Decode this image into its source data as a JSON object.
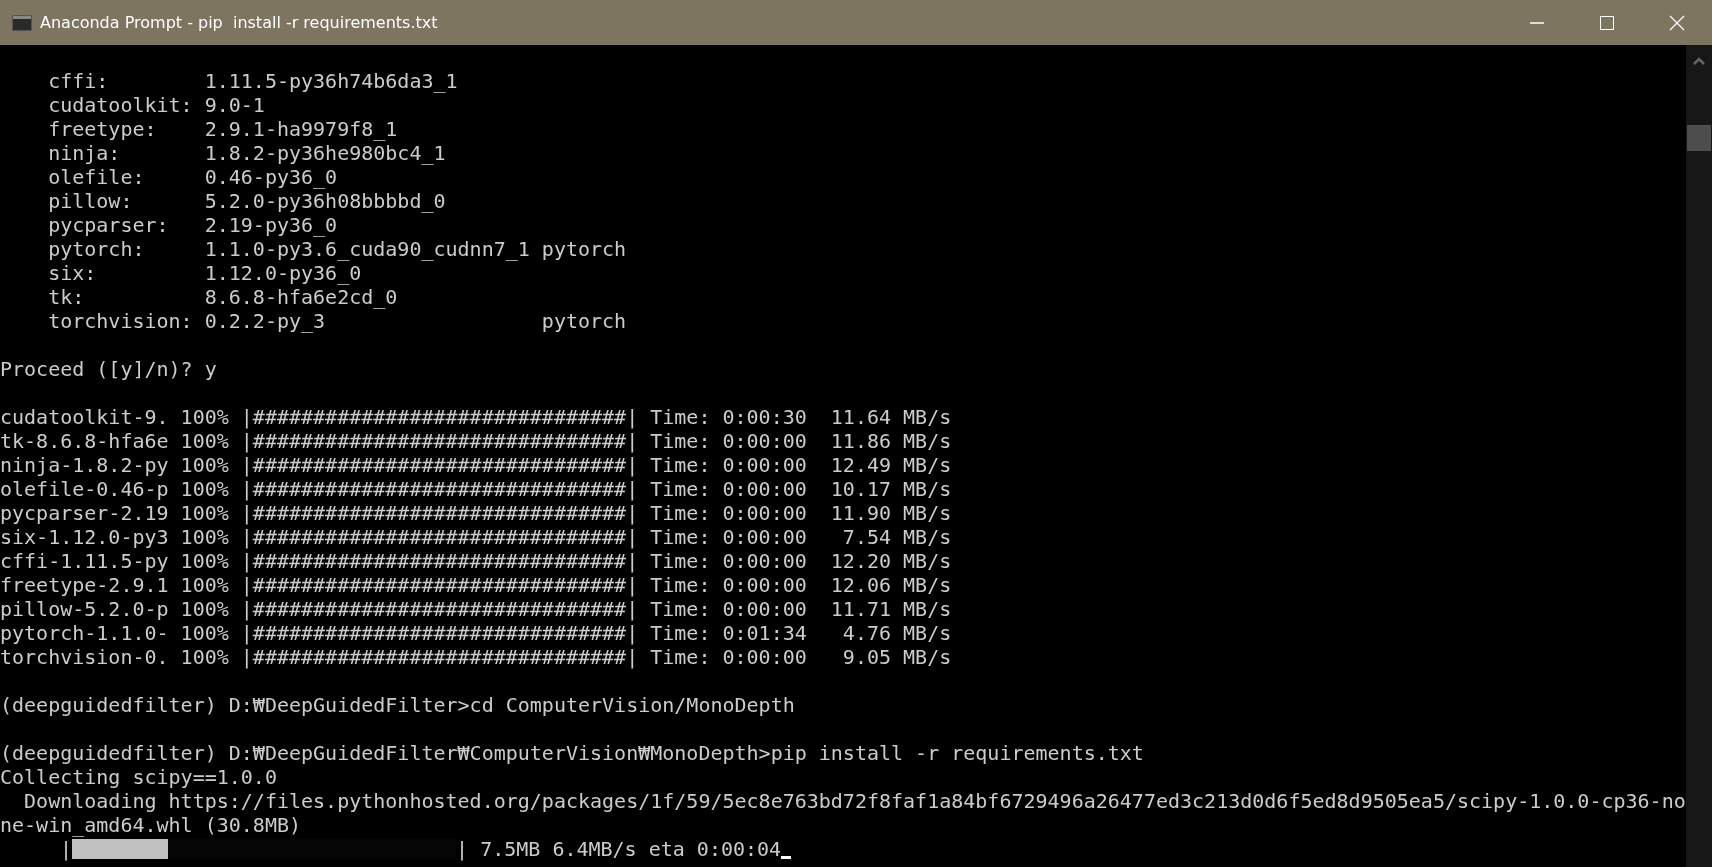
{
  "window": {
    "title": "Anaconda Prompt - pip  install -r requirements.txt"
  },
  "console": {
    "lines": [
      {
        "kind": "blank"
      },
      {
        "kind": "text",
        "text": "    cffi:        1.11.5-py36h74b6da3_1"
      },
      {
        "kind": "text",
        "text": "    cudatoolkit: 9.0-1"
      },
      {
        "kind": "text",
        "text": "    freetype:    2.9.1-ha9979f8_1"
      },
      {
        "kind": "text",
        "text": "    ninja:       1.8.2-py36he980bc4_1"
      },
      {
        "kind": "text",
        "text": "    olefile:     0.46-py36_0"
      },
      {
        "kind": "text",
        "text": "    pillow:      5.2.0-py36h08bbbbd_0"
      },
      {
        "kind": "text",
        "text": "    pycparser:   2.19-py36_0"
      },
      {
        "kind": "text",
        "text": "    pytorch:     1.1.0-py3.6_cuda90_cudnn7_1 pytorch"
      },
      {
        "kind": "text",
        "text": "    six:         1.12.0-py36_0"
      },
      {
        "kind": "text",
        "text": "    tk:          8.6.8-hfa6e2cd_0"
      },
      {
        "kind": "text",
        "text": "    torchvision: 0.2.2-py_3                  pytorch"
      },
      {
        "kind": "blank"
      },
      {
        "kind": "text",
        "text": "Proceed ([y]/n)? y"
      },
      {
        "kind": "blank"
      },
      {
        "kind": "text",
        "text": "cudatoolkit-9. 100% |###############################| Time: 0:00:30  11.64 MB/s"
      },
      {
        "kind": "text",
        "text": "tk-8.6.8-hfa6e 100% |###############################| Time: 0:00:00  11.86 MB/s"
      },
      {
        "kind": "text",
        "text": "ninja-1.8.2-py 100% |###############################| Time: 0:00:00  12.49 MB/s"
      },
      {
        "kind": "text",
        "text": "olefile-0.46-p 100% |###############################| Time: 0:00:00  10.17 MB/s"
      },
      {
        "kind": "text",
        "text": "pycparser-2.19 100% |###############################| Time: 0:00:00  11.90 MB/s"
      },
      {
        "kind": "text",
        "text": "six-1.12.0-py3 100% |###############################| Time: 0:00:00   7.54 MB/s"
      },
      {
        "kind": "text",
        "text": "cffi-1.11.5-py 100% |###############################| Time: 0:00:00  12.20 MB/s"
      },
      {
        "kind": "text",
        "text": "freetype-2.9.1 100% |###############################| Time: 0:00:00  12.06 MB/s"
      },
      {
        "kind": "text",
        "text": "pillow-5.2.0-p 100% |###############################| Time: 0:00:00  11.71 MB/s"
      },
      {
        "kind": "text",
        "text": "pytorch-1.1.0- 100% |###############################| Time: 0:01:34   4.76 MB/s"
      },
      {
        "kind": "text",
        "text": "torchvision-0. 100% |###############################| Time: 0:00:00   9.05 MB/s"
      },
      {
        "kind": "blank"
      },
      {
        "kind": "text",
        "text": "(deepguidedfilter) D:₩DeepGuidedFilter>cd ComputerVision/MonoDepth"
      },
      {
        "kind": "blank"
      },
      {
        "kind": "text",
        "text": "(deepguidedfilter) D:₩DeepGuidedFilter₩ComputerVision₩MonoDepth>pip install -r requirements.txt"
      },
      {
        "kind": "text",
        "text": "Collecting scipy==1.0.0"
      },
      {
        "kind": "text",
        "text": "  Downloading https://files.pythonhosted.org/packages/1f/59/5ec8e763bd72f8faf1a84bf6729496a26477ed3c213d0d6f5ed8d9505ea5/scipy-1.0.0-cp36-no"
      },
      {
        "kind": "text",
        "text": "ne-win_amd64.whl (30.8MB)"
      },
      {
        "kind": "progress",
        "left": "|",
        "level": 0.25,
        "right": "| 7.5MB 6.4MB/s eta 0:00:04"
      }
    ]
  }
}
